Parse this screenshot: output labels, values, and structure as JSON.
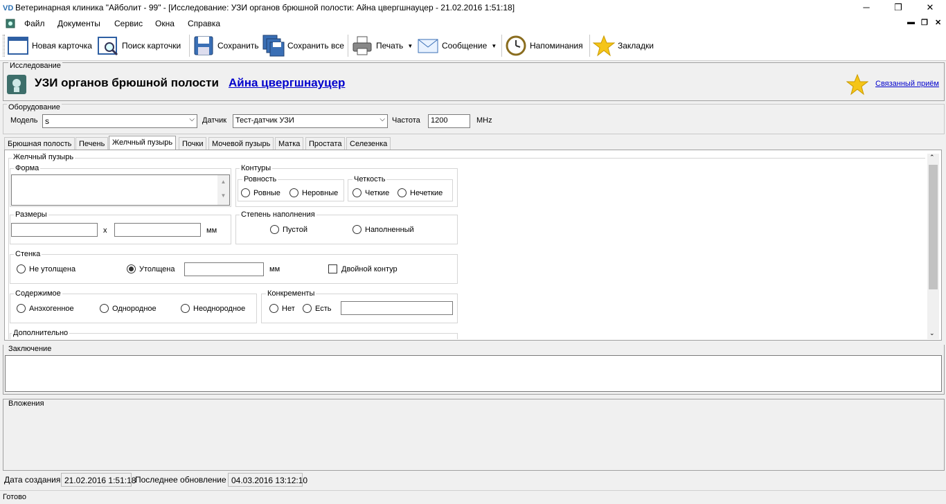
{
  "window": {
    "title": "Ветеринарная клиника \"Айболит - 99\" - [Исследование: УЗИ органов брюшной полости: Айна цвергшнауцер - 21.02.2016 1:51:18]",
    "logo": "VD",
    "minimize": "─",
    "restore": "❐",
    "close": "✕"
  },
  "menu": {
    "items": [
      "Файл",
      "Документы",
      "Сервис",
      "Окна",
      "Справка"
    ],
    "mdi": [
      "▬",
      "❐",
      "✕"
    ]
  },
  "toolbar": {
    "new_card": "Новая карточка",
    "find_card": "Поиск карточки",
    "save": "Сохранить",
    "save_all": "Сохранить все",
    "print": "Печать",
    "message": "Сообщение",
    "reminders": "Напоминания",
    "bookmarks": "Закладки"
  },
  "study": {
    "section": "Исследование",
    "title": "УЗИ органов брюшной полости",
    "patient": "Айна цвергшнауцер",
    "linked": "Связанный приём"
  },
  "equipment": {
    "section": "Оборудование",
    "model_label": "Модель",
    "model_value": "s",
    "sensor_label": "Датчик",
    "sensor_value": "Тест-датчик УЗИ",
    "freq_label": "Частота",
    "freq_value": "1200",
    "freq_unit": "MHz"
  },
  "tabs": [
    "Брюшная полость",
    "Печень",
    "Желчный пузырь",
    "Почки",
    "Мочевой пузырь",
    "Матка",
    "Простата",
    "Селезенка"
  ],
  "gallbladder": {
    "title": "Желчный пузырь",
    "shape_label": "Форма",
    "contours_label": "Контуры",
    "evenness_label": "Ровность",
    "even": "Ровные",
    "uneven": "Неровные",
    "clarity_label": "Четкость",
    "clear": "Четкие",
    "unclear": "Нечеткие",
    "size_label": "Размеры",
    "size_x": "x",
    "size_unit": "мм",
    "fill_label": "Степень наполнения",
    "empty": "Пустой",
    "filled": "Наполненный",
    "wall_label": "Стенка",
    "not_thick": "Не утолщена",
    "thick": "Утолщена",
    "wall_unit": "мм",
    "double": "Двойной контур",
    "content_label": "Содержимое",
    "anechoic": "Анэхогенное",
    "homogeneous": "Однородное",
    "heterogeneous": "Неоднородное",
    "stones_label": "Конкременты",
    "no": "Нет",
    "yes": "Есть",
    "extra_label": "Дополнительно"
  },
  "conclusion": {
    "label": "Заключение"
  },
  "attachments": {
    "label": "Вложения"
  },
  "footer": {
    "created_label": "Дата создания",
    "created_value": "21.02.2016 1:51:18",
    "updated_label": "Последнее обновление",
    "updated_value": "04.03.2016 13:12:10",
    "status": "Готово"
  },
  "colors": {
    "link": "#0000cc",
    "accent": "#f5c518"
  }
}
